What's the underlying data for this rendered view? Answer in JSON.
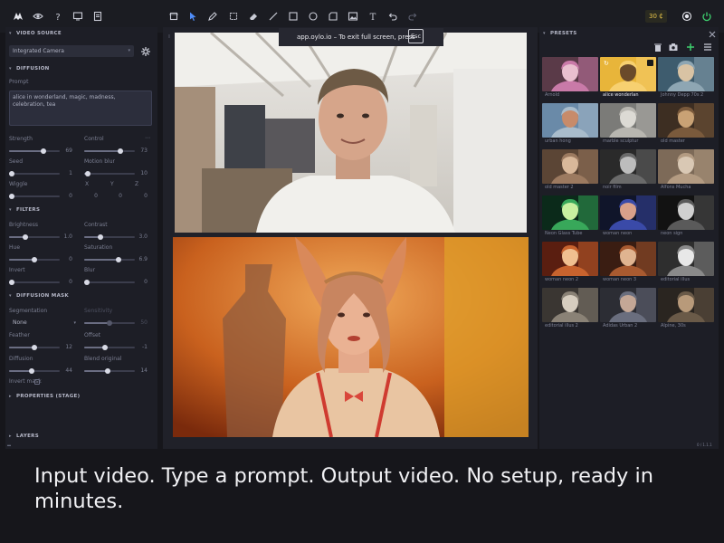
{
  "toolbar": {
    "left_icons": [
      "logo-icon",
      "eye-icon",
      "help-icon",
      "monitor-icon",
      "document-icon"
    ],
    "tools": [
      "frame-tool-icon",
      "pointer-tool-icon",
      "pen-tool-icon",
      "crop-tool-icon",
      "eraser-tool-icon",
      "line-tool-icon",
      "rectangle-tool-icon",
      "circle-tool-icon",
      "shape-tool-icon",
      "image-tool-icon",
      "text-tool-icon",
      "undo-icon",
      "redo-icon"
    ],
    "credits": "30 ₵",
    "right_icons": [
      "record-icon",
      "power-icon"
    ],
    "accent": "#4f8cf7",
    "power_color": "#3ecf6e"
  },
  "left": {
    "video_source": {
      "title": "VIDEO SOURCE",
      "selected": "Integrated Camera"
    },
    "diffusion": {
      "title": "DIFFUSION",
      "prompt_label": "Prompt",
      "prompt": "alice in wonderland, magic, madness, celebration, tea",
      "strength_label": "Strength",
      "strength_value": "69",
      "strength_level": 0.69,
      "control_label": "Control",
      "control_value": "73",
      "control_level": 0.73,
      "seed_label": "Seed",
      "seed_value": "1",
      "seed_level": 0.0,
      "motion_blur_label": "Motion blur",
      "motion_blur_value": "10",
      "motion_blur_level": 0.02,
      "wiggle_label": "Wiggle",
      "wiggle_value": "0",
      "wiggle_level": 0.0,
      "x_label": "X",
      "x_value": "0",
      "y_label": "Y",
      "y_value": "0",
      "z_label": "Z",
      "z_value": "0"
    },
    "filters": {
      "title": "FILTERS",
      "brightness_label": "Brightness",
      "brightness_value": "1.0",
      "brightness_level": 0.3,
      "contrast_label": "Contrast",
      "contrast_value": "3.0",
      "contrast_level": 0.3,
      "hue_label": "Hue",
      "hue_value": "0",
      "hue_level": 0.5,
      "saturation_label": "Saturation",
      "saturation_value": "6.9",
      "saturation_level": 0.7,
      "invert_label": "Invert",
      "invert_value": "0",
      "invert_level": 0.0,
      "blur_label": "Blur",
      "blur_value": "0",
      "blur_level": 0.0
    },
    "diffusion_mask": {
      "title": "DIFFUSION MASK",
      "segmentation_label": "Segmentation",
      "segmentation_selected": "None",
      "sensitivity_label": "Sensitivity",
      "sensitivity_value": "50",
      "sensitivity_level": 0.5,
      "feather_label": "Feather",
      "feather_value": "12",
      "feather_level": 0.5,
      "offset_label": "Offset",
      "offset_value": "-1",
      "offset_level": 0.4,
      "diffusion_label": "Diffusion",
      "diffusion_value": "44",
      "diffusion_level": 0.44,
      "blend_label": "Blend original",
      "blend_value": "14",
      "blend_level": 0.45,
      "invert_mask_label": "Invert mask",
      "invert_mask_checked": false
    },
    "properties_title": "PROPERTIES (STAGE)",
    "layers_title": "LAYERS"
  },
  "stage": {
    "toast_text": "app.oylo.io – To exit full screen, press",
    "toast_key": "Esc",
    "input_tab": "I",
    "output_tab": "O"
  },
  "presets": {
    "title": "PRESETS",
    "actions": [
      "trash-icon",
      "camera-icon",
      "save-icon",
      "add-icon",
      "list-icon"
    ],
    "items": [
      {
        "label": "Arnold"
      },
      {
        "label": "alice wonderlan"
      },
      {
        "label": "Johnny Depp 70s 2"
      },
      {
        "label": "urban hong"
      },
      {
        "label": "marble sculptur"
      },
      {
        "label": "old master"
      },
      {
        "label": "old master 2"
      },
      {
        "label": "noir film"
      },
      {
        "label": "Alfons Mucha"
      },
      {
        "label": "Neon Glass Tube"
      },
      {
        "label": "woman neon"
      },
      {
        "label": "neon sign"
      },
      {
        "label": "woman neon 2"
      },
      {
        "label": "woman neon 3"
      },
      {
        "label": "editorial illus"
      },
      {
        "label": "editorial illus 2"
      },
      {
        "label": "Adidas Urban 2"
      },
      {
        "label": "Alpine, 30s"
      }
    ],
    "selected_index": 1
  },
  "footer_left": "▴▴",
  "footer_right": "0 / 1.1.1",
  "caption": "Input video. Type a prompt. Output video. No setup, ready in minutes."
}
